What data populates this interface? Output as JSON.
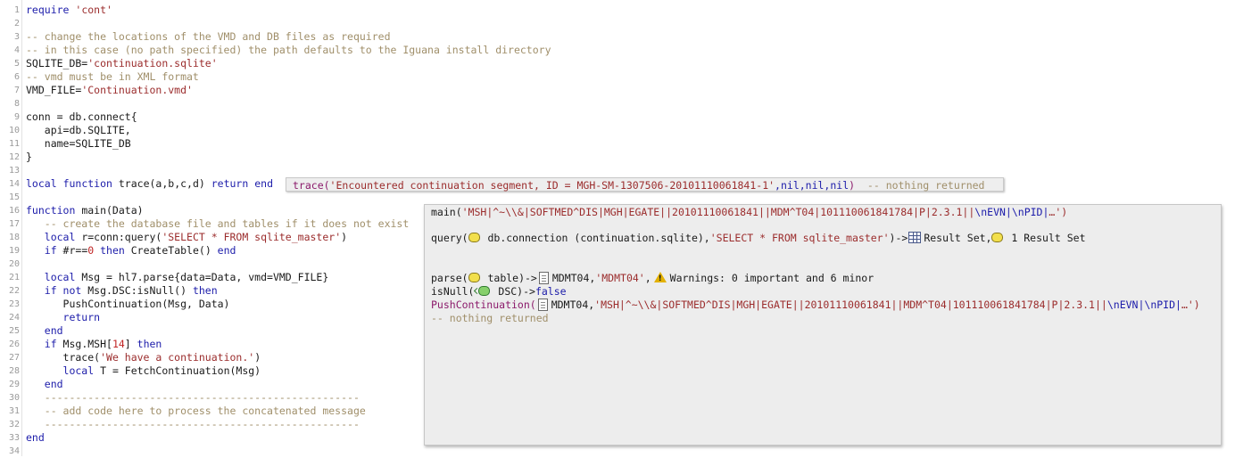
{
  "editor": {
    "line_numbers": [
      "1",
      "2",
      "3",
      "4",
      "5",
      "6",
      "7",
      "8",
      "9",
      "10",
      "11",
      "12",
      "13",
      "14",
      "15",
      "16",
      "17",
      "18",
      "19",
      "20",
      "21",
      "22",
      "23",
      "24",
      "25",
      "26",
      "27",
      "28",
      "29",
      "30",
      "31",
      "32",
      "33",
      "34"
    ],
    "lines": {
      "l1_kw": "require",
      "l1_str": "'cont'",
      "l3": "-- change the locations of the VMD and DB files as required",
      "l4": "-- in this case (no path specified) the path defaults to the Iguana install directory",
      "l5_a": "SQLITE_DB=",
      "l5_str": "'continuation.sqlite'",
      "l6": "-- vmd must be in XML format",
      "l7_a": "VMD_FILE=",
      "l7_str": "'Continuation.vmd'",
      "l9": "conn = db.connect{",
      "l10": "   api=db.SQLITE,",
      "l11": "   name=SQLITE_DB",
      "l12": "}",
      "l14_kw1": "local",
      "l14_kw2": "function",
      "l14_a": " trace(a,b,c,d) ",
      "l14_kw3": "return",
      "l14_kw4": "end",
      "l16_kw": "function",
      "l16_a": " main(Data)",
      "l17": "   -- create the database file and tables if it does not exist",
      "l18_kw": "   local",
      "l18_a": " r=conn:query(",
      "l18_str": "'SELECT * FROM sqlite_master'",
      "l18_b": ")",
      "l19_kw": "   if",
      "l19_a": " #r==",
      "l19_num": "0",
      "l19_kw2": " then",
      "l19_b": " CreateTable() ",
      "l19_kw3": "end",
      "l21_kw": "   local",
      "l21_a": " Msg = hl7.parse{data=Data, vmd=VMD_FILE}",
      "l22_kw": "   if not",
      "l22_a": " Msg.DSC:isNull() ",
      "l22_kw2": "then",
      "l23": "      PushContinuation(Msg, Data)",
      "l24_kw": "      return",
      "l25_kw": "   end",
      "l26_kw": "   if",
      "l26_a": " Msg.MSH[",
      "l26_num": "14",
      "l26_b": "] ",
      "l26_kw2": "then",
      "l27_a": "      trace(",
      "l27_str": "'We have a continuation.'",
      "l27_b": ")",
      "l28_kw": "      local",
      "l28_a": " T = FetchContinuation(Msg)",
      "l29_kw": "   end",
      "l30": "   ---------------------------------------------------",
      "l31": "   -- add code here to process the concatenated message",
      "l32": "   ---------------------------------------------------",
      "l33_kw": "end"
    }
  },
  "trace_annotation": {
    "fn": "trace(",
    "arg": "'Encountered continuation segment, ID = MGH-SM-1307506-20101110061841-1'",
    "nils": ",nil,nil,nil",
    "close": ")",
    "note": "  -- nothing returned"
  },
  "main_panel": {
    "main_fn": "main(",
    "main_arg": "'MSH|^~\\\\&|SOFTMED^DIS|MGH|EGATE||20101110061841||MDM^T04|101110061841784|P|2.3.1||",
    "main_esc1": "\\nEVN|",
    "main_esc2": "\\nPID|",
    "main_tail": "…')",
    "query_fn": "query(",
    "query_conn": " db.connection (continuation.sqlite),",
    "query_str": "'SELECT * FROM sqlite_master'",
    "query_arrow": ")->",
    "query_result1": "Result Set,",
    "query_result2": " 1 Result Set",
    "parse_fn": "parse(",
    "parse_arg": " table)->",
    "parse_res": "MDMT04,",
    "parse_str": "'MDMT04'",
    "parse_comma": ",",
    "parse_warn": "Warnings: 0 important and 6 minor",
    "isnull_fn": "isNull(",
    "isnull_arg": " DSC)->",
    "isnull_val": "false",
    "push_fn": "PushContinuation(",
    "push_res": "MDMT04,",
    "push_arg": "'MSH|^~\\\\&|SOFTMED^DIS|MGH|EGATE||20101110061841||MDM^T04|101110061841784|P|2.3.1||",
    "push_esc1": "\\nEVN|",
    "push_esc2": "\\nPID|",
    "push_tail": "…')",
    "nothing": "-- nothing returned"
  },
  "colors": {
    "keyword": "#1c1caa",
    "string": "#9b2c2c",
    "comment": "#a08f6a",
    "number": "#c02424",
    "annotation_bg": "#eeeeee"
  }
}
